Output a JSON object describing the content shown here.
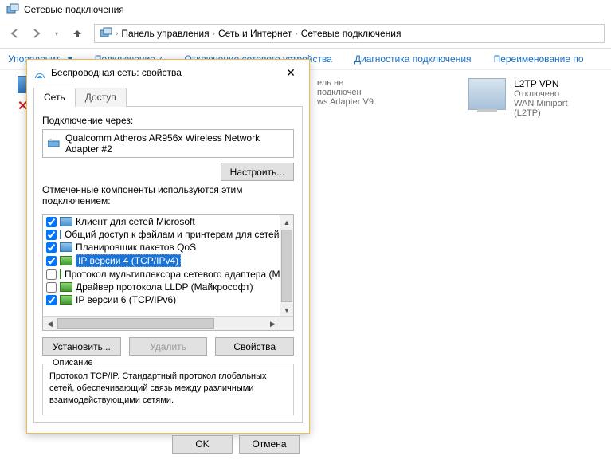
{
  "window_title": "Сетевые подключения",
  "breadcrumbs": [
    "Панель управления",
    "Сеть и Интернет",
    "Сетевые подключения"
  ],
  "toolbar": {
    "organize": "Упорядочить",
    "connect": "Подключение к",
    "disable": "Отключение сетевого устройства",
    "diagnose": "Диагностика подключения",
    "rename": "Переименование по"
  },
  "bg_item1": {
    "line2": "ель не подключен",
    "line3": "ws Adapter V9"
  },
  "bg_item2": {
    "name": "L2TP VPN",
    "status": "Отключено",
    "device": "WAN Miniport (L2TP)"
  },
  "dialog": {
    "title": "Беспроводная сеть: свойства",
    "tabs": {
      "network": "Сеть",
      "access": "Доступ"
    },
    "connect_via": "Подключение через:",
    "adapter": "Qualcomm Atheros AR956x Wireless Network Adapter #2",
    "configure": "Настроить...",
    "components_label": "Отмеченные компоненты используются этим подключением:",
    "components": [
      {
        "checked": true,
        "icon": "blue",
        "label": "Клиент для сетей Microsoft"
      },
      {
        "checked": true,
        "icon": "blue",
        "label": "Общий доступ к файлам и принтерам для сетей Mi"
      },
      {
        "checked": true,
        "icon": "blue",
        "label": "Планировщик пакетов QoS"
      },
      {
        "checked": true,
        "icon": "green",
        "label": "IP версии 4 (TCP/IPv4)",
        "selected": true
      },
      {
        "checked": false,
        "icon": "green",
        "label": "Протокол мультиплексора сетевого адаптера (Ма"
      },
      {
        "checked": false,
        "icon": "green",
        "label": "Драйвер протокола LLDP (Майкрософт)"
      },
      {
        "checked": true,
        "icon": "green",
        "label": "IP версии 6 (TCP/IPv6)"
      }
    ],
    "install": "Установить...",
    "remove": "Удалить",
    "properties": "Свойства",
    "desc_title": "Описание",
    "description": "Протокол TCP/IP. Стандартный протокол глобальных сетей, обеспечивающий связь между различными взаимодействующими сетями.",
    "ok": "OK",
    "cancel": "Отмена"
  }
}
